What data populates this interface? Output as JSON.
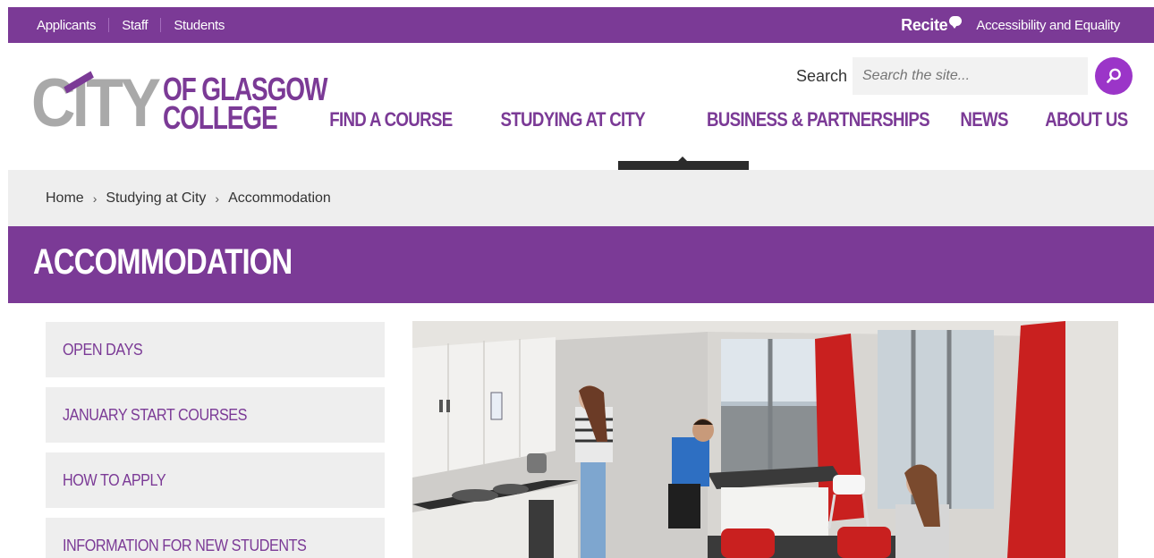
{
  "topbar": {
    "links": [
      "Applicants",
      "Staff",
      "Students"
    ],
    "recite_label": "Recite",
    "accessibility_label": "Accessibility and Equality"
  },
  "header": {
    "logo": {
      "city": "CITY",
      "line1": "OF GLASGOW",
      "line2": "COLLEGE"
    },
    "search": {
      "label": "Search",
      "placeholder": "Search the site..."
    },
    "nav": [
      "FIND A COURSE",
      "STUDYING AT CITY",
      "BUSINESS & PARTNERSHIPS",
      "NEWS",
      "ABOUT US"
    ],
    "active_nav": "STUDYING AT CITY"
  },
  "breadcrumb": [
    "Home",
    "Studying at City",
    "Accommodation"
  ],
  "page_title": "ACCOMMODATION",
  "side_menu": [
    "OPEN DAYS",
    "JANUARY START COURSES",
    "HOW TO APPLY",
    "INFORMATION FOR NEW STUDENTS"
  ],
  "colors": {
    "brand_purple": "#7b3a96",
    "search_button": "#9b35c8",
    "crumb_bg": "#eeeeee"
  },
  "icons": {
    "search_button": "magnifier-icon",
    "recite": "speech-bubble-icon",
    "breadcrumb_separator": "chevron-right-icon"
  }
}
